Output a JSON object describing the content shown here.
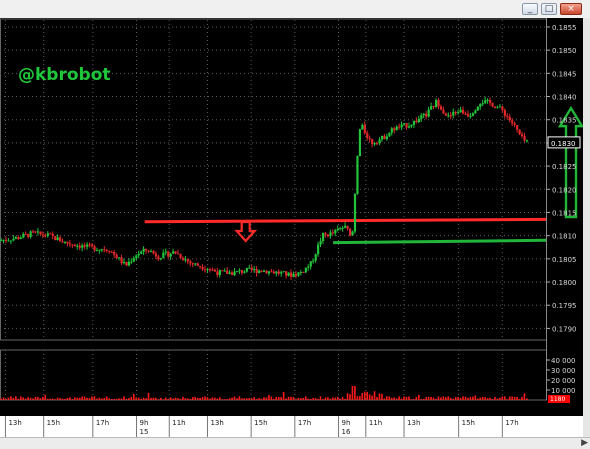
{
  "window": {
    "buttons": {
      "minimize": "_",
      "maximize": "□",
      "close": "×"
    }
  },
  "watermark": "@kbrobot",
  "chart_data": {
    "type": "candlestick",
    "price_axis": {
      "range": [
        0.17875,
        0.18565
      ],
      "ticks": [
        "0.1855",
        "0.1850",
        "0.1845",
        "0.1840",
        "0.1835",
        "0.1830",
        "0.1825",
        "0.1820",
        "0.1815",
        "0.1810",
        "0.1805",
        "0.1800",
        "0.1795",
        "0.1790"
      ],
      "tick_values": [
        0.1855,
        0.185,
        0.1845,
        0.184,
        0.1835,
        0.183,
        0.1825,
        0.182,
        0.1815,
        0.181,
        0.1805,
        0.18,
        0.1795,
        0.179
      ],
      "current_price_label": "0.1830"
    },
    "volume_axis": {
      "ticks": [
        "40 000",
        "30 000",
        "20 000",
        "10 000"
      ],
      "tick_values": [
        40000,
        30000,
        20000,
        10000
      ],
      "max": 42000,
      "current_label": "1180",
      "color": "#ff0000"
    },
    "time_axis": {
      "labels": [
        {
          "t": 0.01,
          "text": "13h"
        },
        {
          "t": 0.08,
          "text": "15h"
        },
        {
          "t": 0.17,
          "text": "17h"
        },
        {
          "t": 0.25,
          "text": "9h"
        },
        {
          "t": 0.31,
          "text": "11h"
        },
        {
          "t": 0.38,
          "text": "13h"
        },
        {
          "t": 0.46,
          "text": "15h"
        },
        {
          "t": 0.54,
          "text": "17h"
        },
        {
          "t": 0.62,
          "text": "9h"
        },
        {
          "t": 0.67,
          "text": "11h"
        },
        {
          "t": 0.74,
          "text": "13h"
        },
        {
          "t": 0.84,
          "text": "15h"
        },
        {
          "t": 0.92,
          "text": "17h"
        }
      ],
      "day_labels": [
        {
          "t": 0.25,
          "text": "15"
        },
        {
          "t": 0.62,
          "text": "16"
        }
      ]
    },
    "levels": [
      {
        "name": "resistance",
        "from_t": 0.265,
        "to_t": 1.0,
        "y_start": 0.1813,
        "y_end": 0.18135,
        "color": "#ff2a2a"
      },
      {
        "name": "support",
        "from_t": 0.61,
        "to_t": 1.0,
        "y_start": 0.18085,
        "y_end": 0.1809,
        "color": "#21b53a"
      }
    ],
    "annotations": [
      {
        "type": "arrow-down",
        "t": 0.45,
        "y": 0.18095,
        "color": "#ff2a2a"
      },
      {
        "type": "arrow-up",
        "t": 1.035,
        "y": 0.18265,
        "color": "#21b53a"
      }
    ],
    "price_path": [
      [
        0.0,
        0.1809
      ],
      [
        0.03,
        0.18095
      ],
      [
        0.06,
        0.18105
      ],
      [
        0.09,
        0.181
      ],
      [
        0.12,
        0.18085
      ],
      [
        0.16,
        0.18075
      ],
      [
        0.2,
        0.1807
      ],
      [
        0.23,
        0.18035
      ],
      [
        0.25,
        0.1806
      ],
      [
        0.27,
        0.1807
      ],
      [
        0.29,
        0.18055
      ],
      [
        0.32,
        0.18065
      ],
      [
        0.35,
        0.1804
      ],
      [
        0.38,
        0.1803
      ],
      [
        0.4,
        0.1802
      ],
      [
        0.43,
        0.1802
      ],
      [
        0.45,
        0.18025
      ],
      [
        0.48,
        0.18025
      ],
      [
        0.51,
        0.1802
      ],
      [
        0.53,
        0.18015
      ],
      [
        0.55,
        0.1802
      ],
      [
        0.57,
        0.1804
      ],
      [
        0.59,
        0.181
      ],
      [
        0.61,
        0.18105
      ],
      [
        0.63,
        0.1812
      ],
      [
        0.645,
        0.181
      ],
      [
        0.655,
        0.1828
      ],
      [
        0.66,
        0.1834
      ],
      [
        0.68,
        0.183
      ],
      [
        0.7,
        0.1831
      ],
      [
        0.72,
        0.1833
      ],
      [
        0.75,
        0.1834
      ],
      [
        0.78,
        0.1836
      ],
      [
        0.8,
        0.1839
      ],
      [
        0.82,
        0.18355
      ],
      [
        0.84,
        0.1837
      ],
      [
        0.86,
        0.1836
      ],
      [
        0.88,
        0.1839
      ],
      [
        0.9,
        0.18385
      ],
      [
        0.92,
        0.1837
      ],
      [
        0.94,
        0.1834
      ],
      [
        0.955,
        0.1831
      ],
      [
        0.965,
        0.183
      ]
    ]
  }
}
